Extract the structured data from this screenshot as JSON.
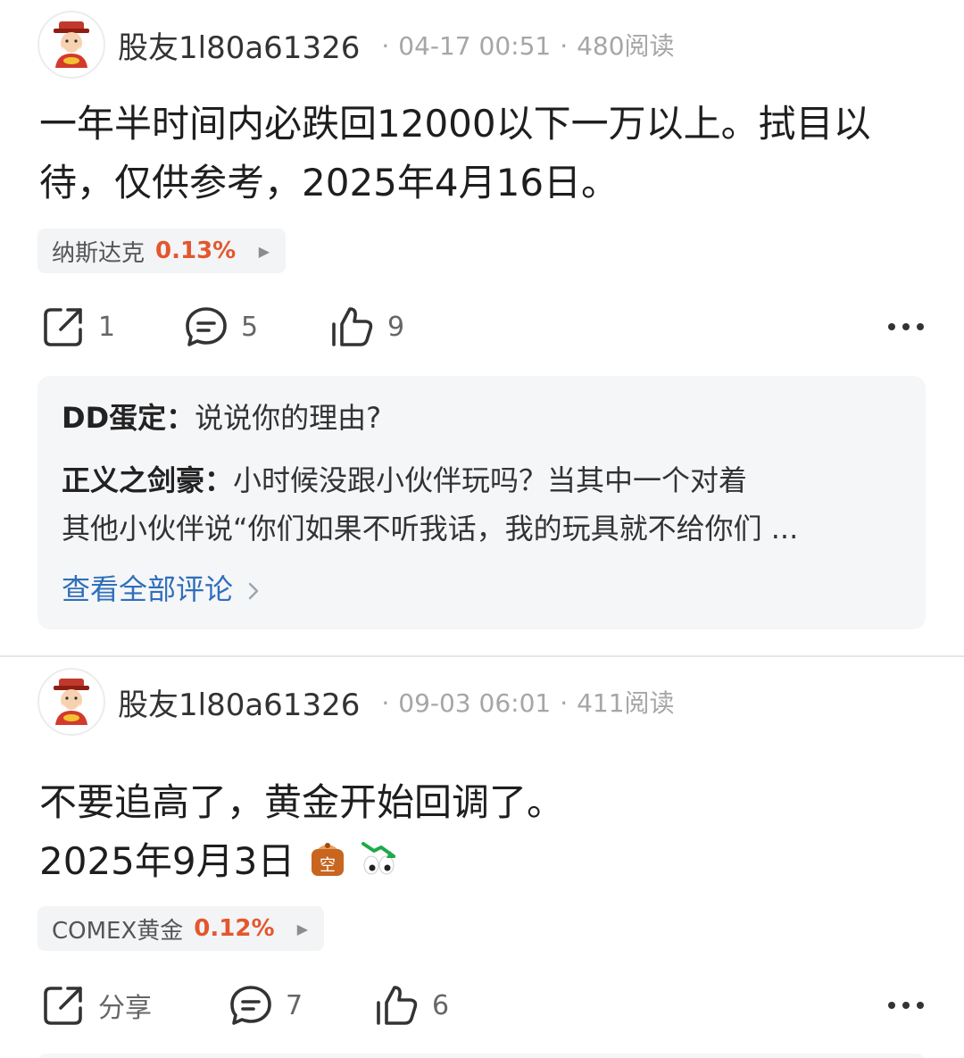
{
  "posts": [
    {
      "username": "股友1l80a61326",
      "time": "04-17 00:51",
      "reads": "480阅读",
      "content_lines": [
        "一年半时间内必跌回12000以下一万以上。拭目以",
        "待，仅供参考，2025年4月16日。"
      ],
      "stock": {
        "name": "纳斯达克",
        "change": "0.13%"
      },
      "actions": {
        "share": "1",
        "comment": "5",
        "like": "9"
      },
      "comments": [
        {
          "author": "DD蛋定：",
          "text": "说说你的理由?"
        },
        {
          "author": "正义之剑豪：",
          "text_line1": "小时候没跟小伙伴玩吗？当其中一个对着",
          "text_line2": "其他小伙伴说“你们如果不听我话，我的玩具就不给你们 ..."
        }
      ],
      "view_all": "查看全部评论"
    },
    {
      "username": "股友1l80a61326",
      "time": "09-03 06:01",
      "reads": "411阅读",
      "content_lines": [
        "不要追高了，黄金开始回调了。",
        "2025年9月3日"
      ],
      "stock": {
        "name": "COMEX黄金",
        "change": "0.12%"
      },
      "actions": {
        "share": "分享",
        "comment": "7",
        "like": "6"
      }
    }
  ],
  "colors": {
    "accent_red": "#e3572e",
    "link_blue": "#2f6fba"
  },
  "icons": [
    "avatar-caishen-icon",
    "share-icon",
    "comment-icon",
    "like-icon",
    "more-icon",
    "chevron-right-icon",
    "short-bag-emoji-icon",
    "eyes-down-emoji-icon"
  ]
}
